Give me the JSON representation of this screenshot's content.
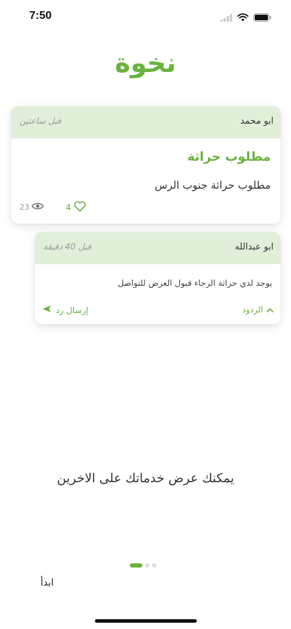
{
  "status_bar": {
    "time": "7:50"
  },
  "app": {
    "title": "نخوة"
  },
  "colors": {
    "accent": "#6ab33f",
    "card_header": "#e1efd9"
  },
  "post": {
    "author": "ابو محمد",
    "time": "قبل ساعتين",
    "title": "مطلوب حراثة",
    "body": "مطلوب حراثة جنوب الرس",
    "views": "23",
    "likes": "4"
  },
  "reply": {
    "author": "ابو عبدالله",
    "time": "قبل 40 دقيقة",
    "body": "يوجد لدي حراثة الرجاء قبول العرض للتواصل",
    "send_label": "إرسال رد",
    "replies_label": "الردود"
  },
  "onboarding": {
    "text": "يمكنك عرض خدماتك على الاخرين",
    "start_label": "ابدأ",
    "page_index": 1,
    "page_count": 3
  }
}
